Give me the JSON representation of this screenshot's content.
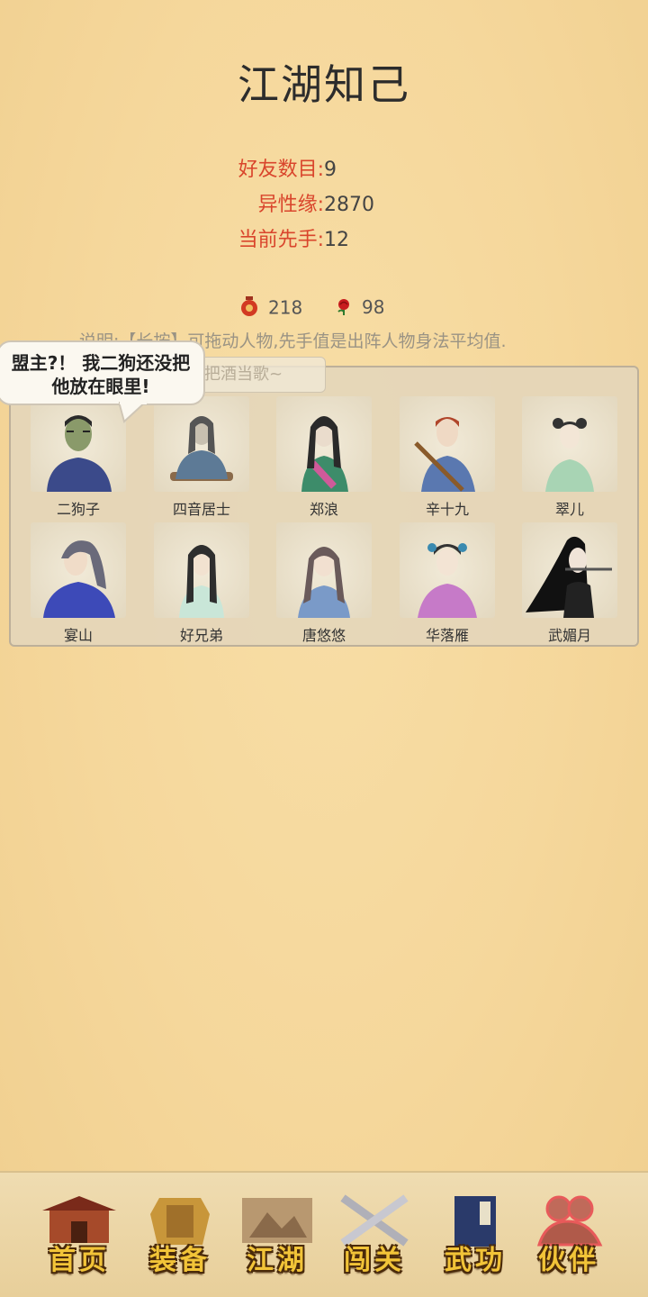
{
  "page_title": "江湖知己",
  "stats": [
    {
      "label": "好友数目:",
      "value": "9"
    },
    {
      "label": "异性缘:",
      "value": "2870"
    },
    {
      "label": "当前先手:",
      "value": "12"
    }
  ],
  "resources": {
    "wine_count": "218",
    "rose_count": "98"
  },
  "note": "说明:【长按】可拖动人物,先手值是出阵人物身法平均值.",
  "ghost_text": "把酒当歌~",
  "bubble": {
    "line1": "盟主?！ 我二狗还没把",
    "line2": "他放在眼里!"
  },
  "characters": [
    {
      "name": "二狗子"
    },
    {
      "name": "四音居士"
    },
    {
      "name": "郑浪"
    },
    {
      "name": "辛十九"
    },
    {
      "name": "翠儿"
    },
    {
      "name": "宴山"
    },
    {
      "name": "好兄弟"
    },
    {
      "name": "唐悠悠"
    },
    {
      "name": "华落雁"
    },
    {
      "name": "武媚月"
    }
  ],
  "nav": [
    {
      "label": "首页",
      "icon": "house-icon"
    },
    {
      "label": "装备",
      "icon": "armor-icon"
    },
    {
      "label": "江湖",
      "icon": "map-scroll-icon"
    },
    {
      "label": "闯关",
      "icon": "crossed-swords-icon"
    },
    {
      "label": "武功",
      "icon": "book-icon"
    },
    {
      "label": "伙伴",
      "icon": "partners-icon"
    }
  ],
  "colors": {
    "accent_red": "#d9452c",
    "nav_gold": "#f2c438",
    "background": "#f5d79b"
  }
}
